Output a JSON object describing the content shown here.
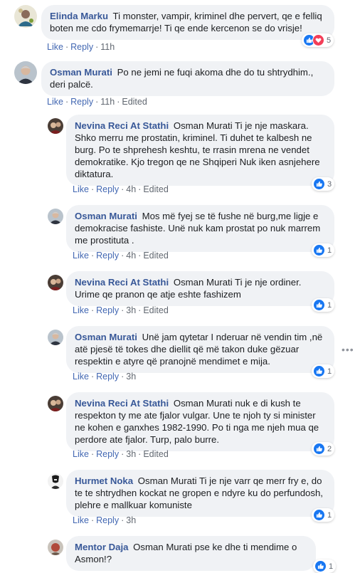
{
  "actions": {
    "like": "Like",
    "reply": "Reply",
    "edited": "Edited"
  },
  "comments": [
    {
      "author": "Elinda Marku",
      "text": "Ti monster, vampir, kriminel dhe pervert, qe e felliq boten me cdo frymemarrje! Ti qe ende kercenon se do vrisje!",
      "time": "11h",
      "edited": false,
      "reactions": "5",
      "reaction_types": [
        "like",
        "love"
      ]
    },
    {
      "author": "Osman Murati",
      "text": "Po ne jemi ne fuqi akoma dhe do tu shtrydhim., deri palcë.",
      "time": "11h",
      "edited": true,
      "reactions": "",
      "reaction_types": []
    },
    {
      "author": "Nevina Reci At Stathi",
      "text": "Osman Murati Ti je nje maskara. Shko merru me prostatin, kriminel. Ti duhet te kalbesh ne burg. Po te shprehesh keshtu, te rrasin mrena ne vendet demokratike. Kjo tregon qe ne Shqiperi Nuk iken asnjehere diktatura.",
      "time": "4h",
      "edited": true,
      "reactions": "3",
      "reaction_types": [
        "like"
      ]
    },
    {
      "author": "Osman Murati",
      "text": "Mos më fyej se të fushe në burg,me ligje e demokracise fashiste. Unë nuk kam prostat po nuk marrem me prostituta .",
      "time": "4h",
      "edited": true,
      "reactions": "1",
      "reaction_types": [
        "like"
      ]
    },
    {
      "author": "Nevina Reci At Stathi",
      "text": "Osman Murati Ti je nje ordiner. Urime qe pranon qe atje eshte fashizem",
      "time": "3h",
      "edited": true,
      "reactions": "1",
      "reaction_types": [
        "like"
      ]
    },
    {
      "author": "Osman Murati",
      "text": "Unë jam qytetar I nderuar në vendin tim ,në atë pjesë të tokes dhe diellit që më takon duke gëzuar respektin e atyre që pranojnë mendimet e mija.",
      "time": "3h",
      "edited": false,
      "reactions": "1",
      "reaction_types": [
        "like"
      ]
    },
    {
      "author": "Nevina Reci At Stathi",
      "text": "Osman Murati nuk e di kush te respekton ty me ate fjalor vulgar. Une te njoh ty si minister ne kohen e ganxhes 1982-1990. Po ti nga me njeh mua qe perdore ate fjalor. Turp, palo burre.",
      "time": "3h",
      "edited": true,
      "reactions": "2",
      "reaction_types": [
        "like"
      ]
    },
    {
      "author": "Hurmet Noka",
      "text": "Osman Murati Ti je nje varr qe merr fry e, do te te shtrydhen kockat ne gropen e ndyre ku do perfundosh, plehre e mallkuar komuniste",
      "time": "3h",
      "edited": false,
      "reactions": "1",
      "reaction_types": [
        "like"
      ]
    },
    {
      "author": "Mentor Daja",
      "text": "Osman Murati pse ke dhe ti mendime o Asmon!?",
      "time": "",
      "edited": false,
      "reactions": "1",
      "reaction_types": [
        "like"
      ]
    }
  ],
  "more_options_icon": "more-horizontal-icon",
  "colors": {
    "author": "#385898",
    "link": "#4267b2",
    "bubble": "#f0f2f5",
    "like": "#1877f2",
    "love": "#f33e58"
  }
}
